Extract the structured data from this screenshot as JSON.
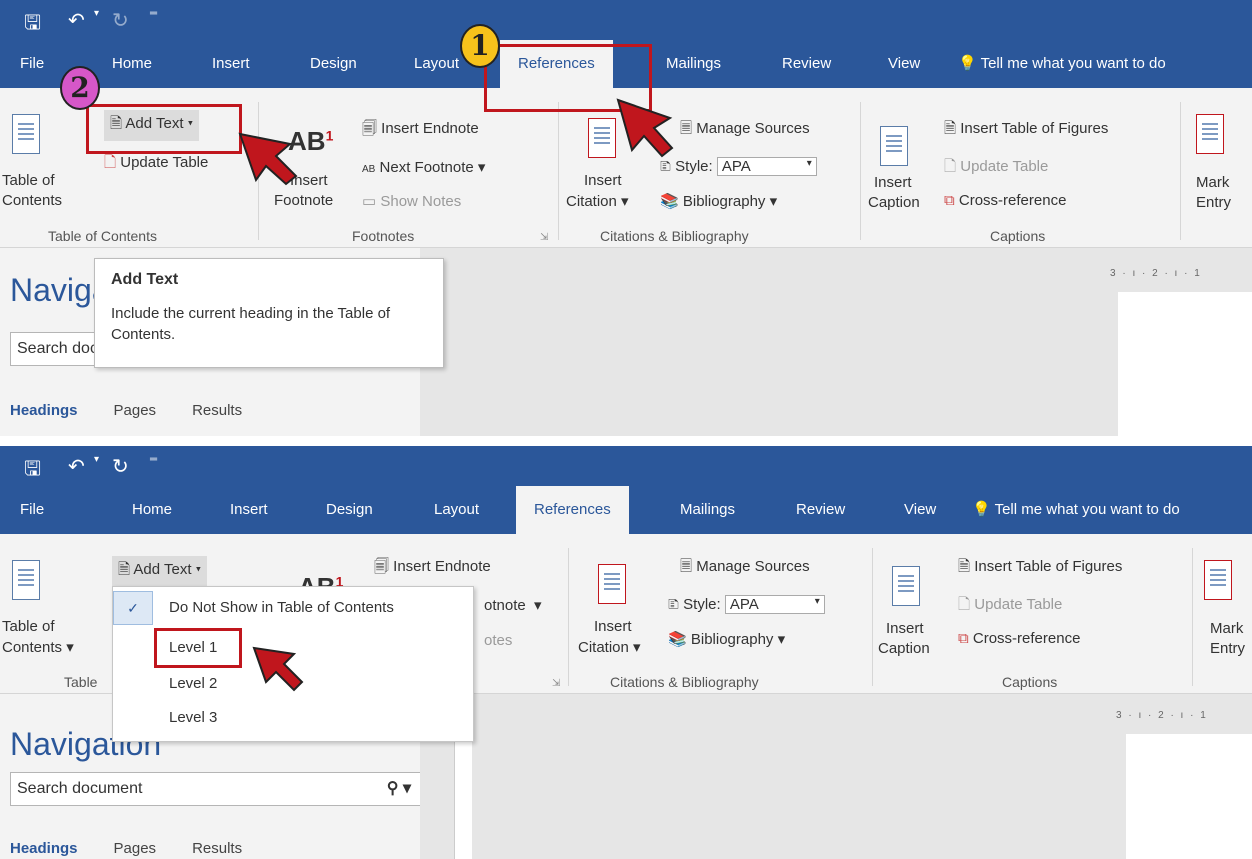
{
  "tabs": [
    "File",
    "Home",
    "Insert",
    "Design",
    "Layout",
    "References",
    "Mailings",
    "Review",
    "View"
  ],
  "tell_me": "Tell me what you want to do",
  "toc": {
    "add_text": "Add Text",
    "update_table": "Update Table",
    "big_label_1": "Table of",
    "big_label_2": "Contents",
    "group": "Table of Contents"
  },
  "footnotes": {
    "insert_endnote": "Insert Endnote",
    "next_footnote": "Next Footnote",
    "show_notes": "Show Notes",
    "insert_1": "Insert",
    "insert_2": "Footnote",
    "group": "Footnotes",
    "ab": "AB",
    "sup": "1"
  },
  "citations": {
    "manage_sources": "Manage Sources",
    "style_label": "Style:",
    "style_value": "APA",
    "bibliography": "Bibliography",
    "insert_1": "Insert",
    "insert_2": "Citation",
    "group": "Citations & Bibliography"
  },
  "captions": {
    "insert_table_of_figures": "Insert Table of Figures",
    "update_table": "Update Table",
    "cross_reference": "Cross-reference",
    "insert_1": "Insert",
    "insert_2": "Caption",
    "group": "Captions"
  },
  "index": {
    "mark_1": "Mark",
    "mark_2": "Entry"
  },
  "navigation": {
    "title": "Navigation",
    "search_placeholder": "Search document",
    "tabs": [
      "Headings",
      "Pages",
      "Results"
    ]
  },
  "tooltip": {
    "title": "Add Text",
    "body": "Include the current heading in the Table of Contents."
  },
  "menu": {
    "items": [
      "Do Not Show in Table of Contents",
      "Level 1",
      "Level 2",
      "Level 3"
    ],
    "checked": "✓"
  },
  "ruler_text": "3 · ı · 2 · ı · 1",
  "badges": [
    "1",
    "2"
  ],
  "colors": {
    "title_bar": "#2b579a",
    "ribbon": "#f3f3f3",
    "highlight": "#c0161d",
    "badge_1": "#f7c21b",
    "badge_2": "#d657c8"
  }
}
